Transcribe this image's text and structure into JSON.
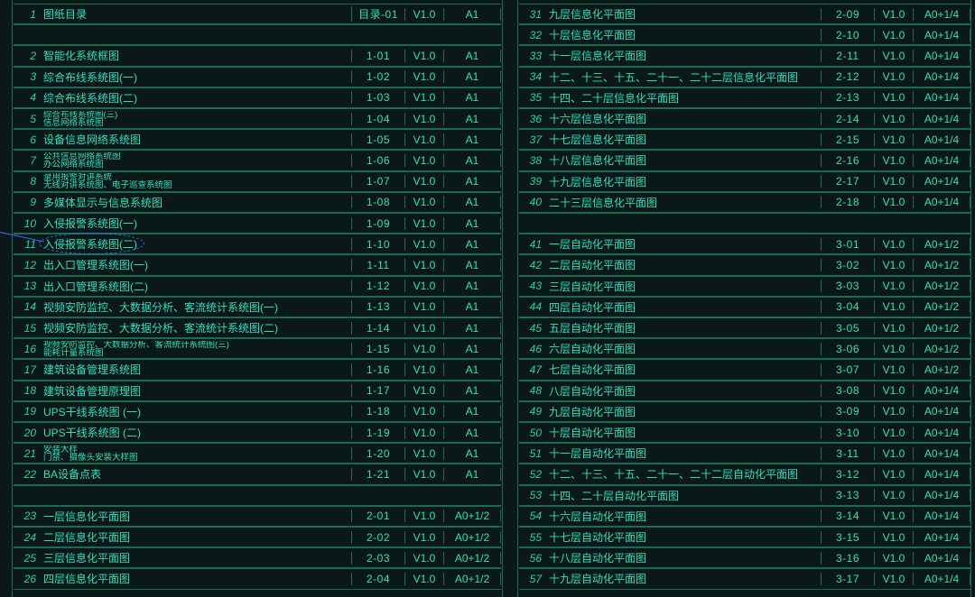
{
  "left": [
    {
      "n": "1",
      "desc": "图纸目录",
      "code": "目录-01",
      "ver": "V1.0",
      "size": "A1"
    },
    {
      "gap": true
    },
    {
      "n": "2",
      "desc": "智能化系统框图",
      "code": "1-01",
      "ver": "V1.0",
      "size": "A1"
    },
    {
      "n": "3",
      "desc": "综合布线系统图(一)",
      "code": "1-02",
      "ver": "V1.0",
      "size": "A1"
    },
    {
      "n": "4",
      "desc": "综合布线系统图(二)",
      "code": "1-03",
      "ver": "V1.0",
      "size": "A1"
    },
    {
      "n": "5",
      "desc": "综合布线系统图(三)\n信息网络系统图",
      "code": "1-04",
      "ver": "V1.0",
      "size": "A1",
      "two": true
    },
    {
      "n": "6",
      "desc": "设备信息网络系统图",
      "code": "1-05",
      "ver": "V1.0",
      "size": "A1"
    },
    {
      "n": "7",
      "desc": "公共信息网络系统图\n办公网络系统图",
      "code": "1-06",
      "ver": "V1.0",
      "size": "A1",
      "two": true
    },
    {
      "n": "8",
      "desc": "录用报警对讲系统\n无线对讲系统图、电子巡查系统图",
      "code": "1-07",
      "ver": "V1.0",
      "size": "A1",
      "two": true
    },
    {
      "n": "9",
      "desc": "多媒体显示与信息系统图",
      "code": "1-08",
      "ver": "V1.0",
      "size": "A1"
    },
    {
      "n": "10",
      "desc": "入侵报警系统图(一)",
      "code": "1-09",
      "ver": "V1.0",
      "size": "A1"
    },
    {
      "n": "11",
      "desc": "入侵报警系统图(二)",
      "code": "1-10",
      "ver": "V1.0",
      "size": "A1",
      "hl": true
    },
    {
      "n": "12",
      "desc": "出入口管理系统图(一)",
      "code": "1-11",
      "ver": "V1.0",
      "size": "A1"
    },
    {
      "n": "13",
      "desc": "出入口管理系统图(二)",
      "code": "1-12",
      "ver": "V1.0",
      "size": "A1"
    },
    {
      "n": "14",
      "desc": "视频安防监控、大数据分析、客流统计系统图(一)",
      "code": "1-13",
      "ver": "V1.0",
      "size": "A1"
    },
    {
      "n": "15",
      "desc": "视频安防监控、大数据分析、客流统计系统图(二)",
      "code": "1-14",
      "ver": "V1.0",
      "size": "A1"
    },
    {
      "n": "16",
      "desc": "视频安防监控、大数据分析、客流统计系统图(三)\n能耗计量系统图",
      "code": "1-15",
      "ver": "V1.0",
      "size": "A1",
      "two": true
    },
    {
      "n": "17",
      "desc": "建筑设备管理系统图",
      "code": "1-16",
      "ver": "V1.0",
      "size": "A1"
    },
    {
      "n": "18",
      "desc": "建筑设备管理原理图",
      "code": "1-17",
      "ver": "V1.0",
      "size": "A1"
    },
    {
      "n": "19",
      "desc": "UPS干线系统图 (一)",
      "code": "1-18",
      "ver": "V1.0",
      "size": "A1"
    },
    {
      "n": "20",
      "desc": "UPS干线系统图 (二)",
      "code": "1-19",
      "ver": "V1.0",
      "size": "A1"
    },
    {
      "n": "21",
      "desc": "安装大样\n门禁、摄像头安装大样图",
      "code": "1-20",
      "ver": "V1.0",
      "size": "A1",
      "two": true
    },
    {
      "n": "22",
      "desc": "BA设备点表",
      "code": "1-21",
      "ver": "V1.0",
      "size": "A1"
    },
    {
      "gap": true
    },
    {
      "n": "23",
      "desc": "一层信息化平面图",
      "code": "2-01",
      "ver": "V1.0",
      "size": "A0+1/2"
    },
    {
      "n": "24",
      "desc": "二层信息化平面图",
      "code": "2-02",
      "ver": "V1.0",
      "size": "A0+1/2"
    },
    {
      "n": "25",
      "desc": "三层信息化平面图",
      "code": "2-03",
      "ver": "V1.0",
      "size": "A0+1/2"
    },
    {
      "n": "26",
      "desc": "四层信息化平面图",
      "code": "2-04",
      "ver": "V1.0",
      "size": "A0+1/2"
    }
  ],
  "right": [
    {
      "n": "31",
      "desc": "九层信息化平面图",
      "code": "2-09",
      "ver": "V1.0",
      "size": "A0+1/4"
    },
    {
      "n": "32",
      "desc": "十层信息化平面图",
      "code": "2-10",
      "ver": "V1.0",
      "size": "A0+1/4"
    },
    {
      "n": "33",
      "desc": "十一层信息化平面图",
      "code": "2-11",
      "ver": "V1.0",
      "size": "A0+1/4"
    },
    {
      "n": "34",
      "desc": "十二、十三、十五、二十一、二十二层信息化平面图",
      "code": "2-12",
      "ver": "V1.0",
      "size": "A0+1/4"
    },
    {
      "n": "35",
      "desc": "十四、二十层信息化平面图",
      "code": "2-13",
      "ver": "V1.0",
      "size": "A0+1/4"
    },
    {
      "n": "36",
      "desc": "十六层信息化平面图",
      "code": "2-14",
      "ver": "V1.0",
      "size": "A0+1/4"
    },
    {
      "n": "37",
      "desc": "十七层信息化平面图",
      "code": "2-15",
      "ver": "V1.0",
      "size": "A0+1/4"
    },
    {
      "n": "38",
      "desc": "十八层信息化平面图",
      "code": "2-16",
      "ver": "V1.0",
      "size": "A0+1/4"
    },
    {
      "n": "39",
      "desc": "十九层信息化平面图",
      "code": "2-17",
      "ver": "V1.0",
      "size": "A0+1/4"
    },
    {
      "n": "40",
      "desc": "二十三层信息化平面图",
      "code": "2-18",
      "ver": "V1.0",
      "size": "A0+1/4"
    },
    {
      "gap": true
    },
    {
      "n": "41",
      "desc": "一层自动化平面图",
      "code": "3-01",
      "ver": "V1.0",
      "size": "A0+1/2"
    },
    {
      "n": "42",
      "desc": "二层自动化平面图",
      "code": "3-02",
      "ver": "V1.0",
      "size": "A0+1/2"
    },
    {
      "n": "43",
      "desc": "三层自动化平面图",
      "code": "3-03",
      "ver": "V1.0",
      "size": "A0+1/2"
    },
    {
      "n": "44",
      "desc": "四层自动化平面图",
      "code": "3-04",
      "ver": "V1.0",
      "size": "A0+1/2"
    },
    {
      "n": "45",
      "desc": "五层自动化平面图",
      "code": "3-05",
      "ver": "V1.0",
      "size": "A0+1/2"
    },
    {
      "n": "46",
      "desc": "六层自动化平面图",
      "code": "3-06",
      "ver": "V1.0",
      "size": "A0+1/2"
    },
    {
      "n": "47",
      "desc": "七层自动化平面图",
      "code": "3-07",
      "ver": "V1.0",
      "size": "A0+1/2"
    },
    {
      "n": "48",
      "desc": "八层自动化平面图",
      "code": "3-08",
      "ver": "V1.0",
      "size": "A0+1/4"
    },
    {
      "n": "49",
      "desc": "九层自动化平面图",
      "code": "3-09",
      "ver": "V1.0",
      "size": "A0+1/4"
    },
    {
      "n": "50",
      "desc": "十层自动化平面图",
      "code": "3-10",
      "ver": "V1.0",
      "size": "A0+1/4"
    },
    {
      "n": "51",
      "desc": "十一层自动化平面图",
      "code": "3-11",
      "ver": "V1.0",
      "size": "A0+1/4"
    },
    {
      "n": "52",
      "desc": "十二、十三、十五、二十一、二十二层自动化平面图",
      "code": "3-12",
      "ver": "V1.0",
      "size": "A0+1/4"
    },
    {
      "n": "53",
      "desc": "十四、二十层自动化平面图",
      "code": "3-13",
      "ver": "V1.0",
      "size": "A0+1/4"
    },
    {
      "n": "54",
      "desc": "十六层自动化平面图",
      "code": "3-14",
      "ver": "V1.0",
      "size": "A0+1/4"
    },
    {
      "n": "55",
      "desc": "十七层自动化平面图",
      "code": "3-15",
      "ver": "V1.0",
      "size": "A0+1/4"
    },
    {
      "n": "56",
      "desc": "十八层自动化平面图",
      "code": "3-16",
      "ver": "V1.0",
      "size": "A0+1/4"
    },
    {
      "n": "57",
      "desc": "十九层自动化平面图",
      "code": "3-17",
      "ver": "V1.0",
      "size": "A0+1/4"
    }
  ]
}
